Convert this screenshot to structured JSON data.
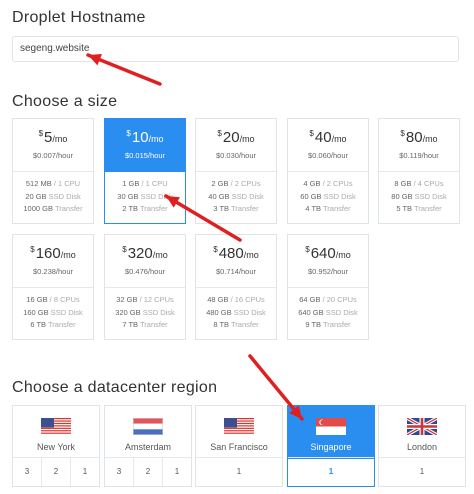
{
  "hostname": {
    "title": "Droplet Hostname",
    "value": "segeng.website"
  },
  "size_section": {
    "title": "Choose a size",
    "currency_symbol": "$",
    "per_month": "/mo",
    "sizes": [
      {
        "price": "5",
        "hourly": "$0.007/hour",
        "ram": "512 MB",
        "cpu": "1 CPU",
        "disk": "20 GB",
        "transfer": "1000 GB"
      },
      {
        "price": "10",
        "hourly": "$0.015/hour",
        "ram": "1 GB",
        "cpu": "1 CPU",
        "disk": "30 GB",
        "transfer": "2 TB"
      },
      {
        "price": "20",
        "hourly": "$0.030/hour",
        "ram": "2 GB",
        "cpu": "2 CPUs",
        "disk": "40 GB",
        "transfer": "3 TB"
      },
      {
        "price": "40",
        "hourly": "$0.060/hour",
        "ram": "4 GB",
        "cpu": "2 CPUs",
        "disk": "60 GB",
        "transfer": "4 TB"
      },
      {
        "price": "80",
        "hourly": "$0.119/hour",
        "ram": "8 GB",
        "cpu": "4 CPUs",
        "disk": "80 GB",
        "transfer": "5 TB"
      },
      {
        "price": "160",
        "hourly": "$0.238/hour",
        "ram": "16 GB",
        "cpu": "8 CPUs",
        "disk": "160 GB",
        "transfer": "6 TB"
      },
      {
        "price": "320",
        "hourly": "$0.476/hour",
        "ram": "32 GB",
        "cpu": "12 CPUs",
        "disk": "320 GB",
        "transfer": "7 TB"
      },
      {
        "price": "480",
        "hourly": "$0.714/hour",
        "ram": "48 GB",
        "cpu": "16 CPUs",
        "disk": "480 GB",
        "transfer": "8 TB"
      },
      {
        "price": "640",
        "hourly": "$0.952/hour",
        "ram": "64 GB",
        "cpu": "20 CPUs",
        "disk": "640 GB",
        "transfer": "9 TB"
      }
    ],
    "disk_suffix": "SSD Disk",
    "transfer_suffix": "Transfer",
    "selected_index": 1
  },
  "region_section": {
    "title": "Choose a datacenter region",
    "regions": [
      {
        "name": "New York",
        "flag": "us-flag-icon",
        "numbers": [
          "3",
          "2",
          "1"
        ]
      },
      {
        "name": "Amsterdam",
        "flag": "nl-flag-icon",
        "numbers": [
          "3",
          "2",
          "1"
        ]
      },
      {
        "name": "San Francisco",
        "flag": "us-flag-icon",
        "numbers": [
          "1"
        ]
      },
      {
        "name": "Singapore",
        "flag": "sg-flag-icon",
        "numbers": [
          "1"
        ]
      },
      {
        "name": "London",
        "flag": "uk-flag-icon",
        "numbers": [
          "1"
        ]
      }
    ],
    "selected_index": 3
  },
  "colors": {
    "accent": "#2a8ef0",
    "annotation_arrow": "#e02020"
  }
}
